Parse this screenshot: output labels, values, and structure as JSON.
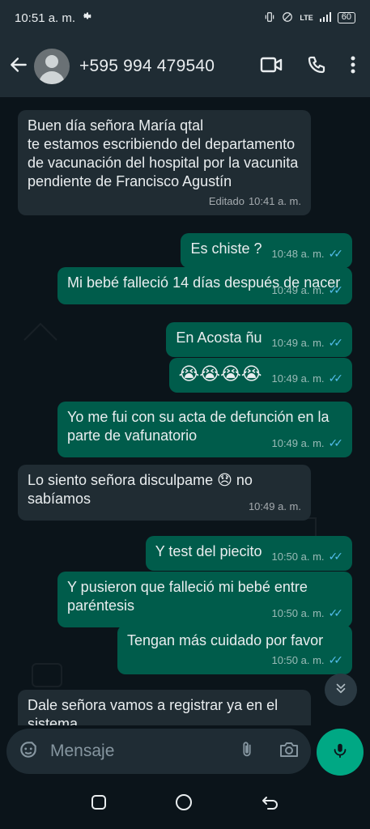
{
  "status_bar": {
    "time": "10:51 a. m.",
    "network": "LTE",
    "battery": "60"
  },
  "header": {
    "contact": "+595 994 479540"
  },
  "messages": [
    {
      "dir": "in",
      "text": "Buen día señora María qtal\nte estamos escribiendo del departamento de vacunación del hospital por la vacunita  pendiente de Francisco  Agustín",
      "edited": "Editado",
      "time": "10:41 a. m."
    },
    {
      "dir": "out",
      "text": "Es chiste ?",
      "time": "10:48 a. m."
    },
    {
      "dir": "out",
      "text": "Mi bebé falleció 14 días después de nacer",
      "time": "10:49 a. m."
    },
    {
      "dir": "out",
      "text": "En Acosta ñu",
      "time": "10:49 a. m."
    },
    {
      "dir": "out",
      "text": "😭😭😭😭",
      "time": "10:49 a. m."
    },
    {
      "dir": "out",
      "text": "Yo me fui con su acta de defunción en la parte de vafunatorio",
      "time": "10:49 a. m."
    },
    {
      "dir": "in",
      "text": "Lo siento señora disculpame 😞 no sabíamos",
      "time": "10:49 a. m."
    },
    {
      "dir": "out",
      "text": "Y test del piecito",
      "time": "10:50 a. m."
    },
    {
      "dir": "out",
      "text": "Y pusieron que falleció mi bebé entre paréntesis",
      "time": "10:50 a. m."
    },
    {
      "dir": "out",
      "text": "Tengan más cuidado por favor",
      "time": "10:50 a. m."
    },
    {
      "dir": "in",
      "text": "Dale señora vamos a registrar ya en el sistema"
    }
  ],
  "composer": {
    "placeholder": "Mensaje"
  },
  "icons": {
    "back": "arrow-left-icon",
    "video": "video-camera-icon",
    "call": "phone-icon",
    "menu": "more-vert-icon",
    "sticker": "sticker-icon",
    "attach": "paperclip-icon",
    "camera": "camera-icon",
    "mic": "microphone-icon",
    "scroll": "double-chevron-down-icon"
  },
  "colors": {
    "incoming": "#202c33",
    "outgoing": "#005c4b",
    "accent": "#00a884",
    "read_ticks": "#53bdeb"
  }
}
